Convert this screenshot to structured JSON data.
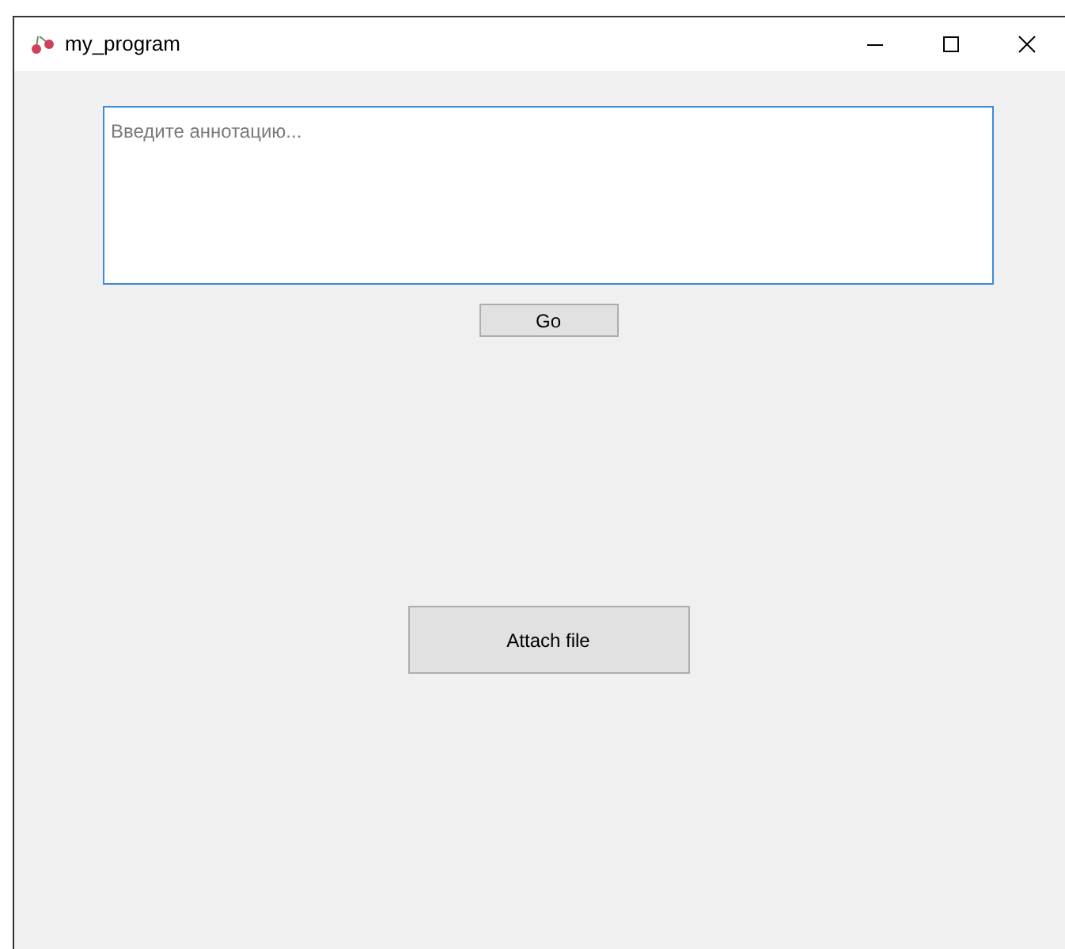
{
  "window": {
    "title": "my_program"
  },
  "annotation_field": {
    "placeholder": "Введите аннотацию..."
  },
  "buttons": [
    {
      "label": "Go",
      "kind": "small"
    },
    {
      "label": "Attach file",
      "kind": "large"
    }
  ]
}
